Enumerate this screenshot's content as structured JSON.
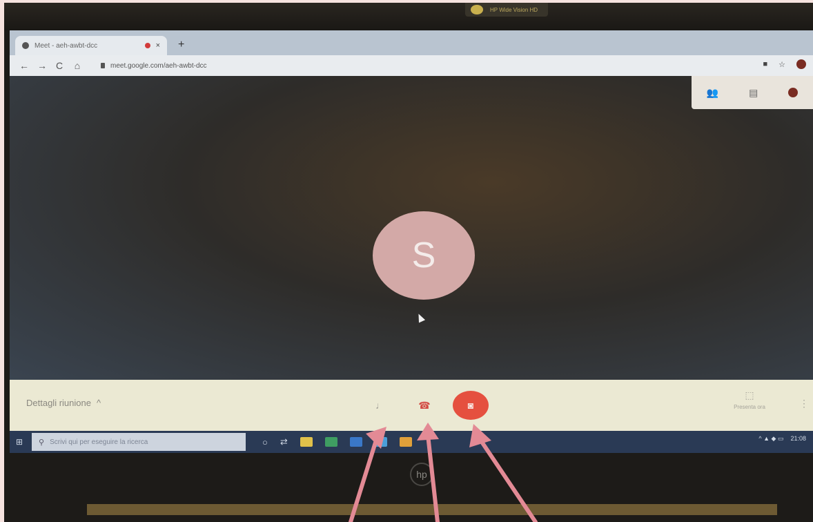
{
  "browser": {
    "tab_title": "Meet - aeh-awbt-dcc",
    "new_tab": "+",
    "tab_close": "×",
    "nav": {
      "back": "←",
      "forward": "→",
      "reload": "C",
      "home": "⌂"
    },
    "url": "meet.google.com/aeh-awbt-dcc",
    "icons": {
      "camera": "■",
      "star": "☆"
    }
  },
  "meet": {
    "top_panel": {
      "people": "👥",
      "chat": "▤"
    },
    "avatar_letter": "S",
    "meeting_details": "Dettagli riunione",
    "meeting_details_chevron": "^",
    "present_icon": "⬚",
    "present_label": "Presenta ora",
    "more": "⋮",
    "mic_icon": "♩",
    "hangup_icon": "☎",
    "camera_icon": "◙",
    "accent": "#e5503f"
  },
  "taskbar": {
    "start": "⊞",
    "search_icon": "⚲",
    "search_placeholder": "Scrivi qui per eseguire la ricerca",
    "task_icons": [
      "○",
      "⇄"
    ],
    "tray": "^  ▲  ◆  ▭",
    "time": "21:08"
  },
  "device": {
    "camera_label": "HP Wide Vision HD",
    "brand": "hp"
  },
  "annotation_color": "#e38a95"
}
